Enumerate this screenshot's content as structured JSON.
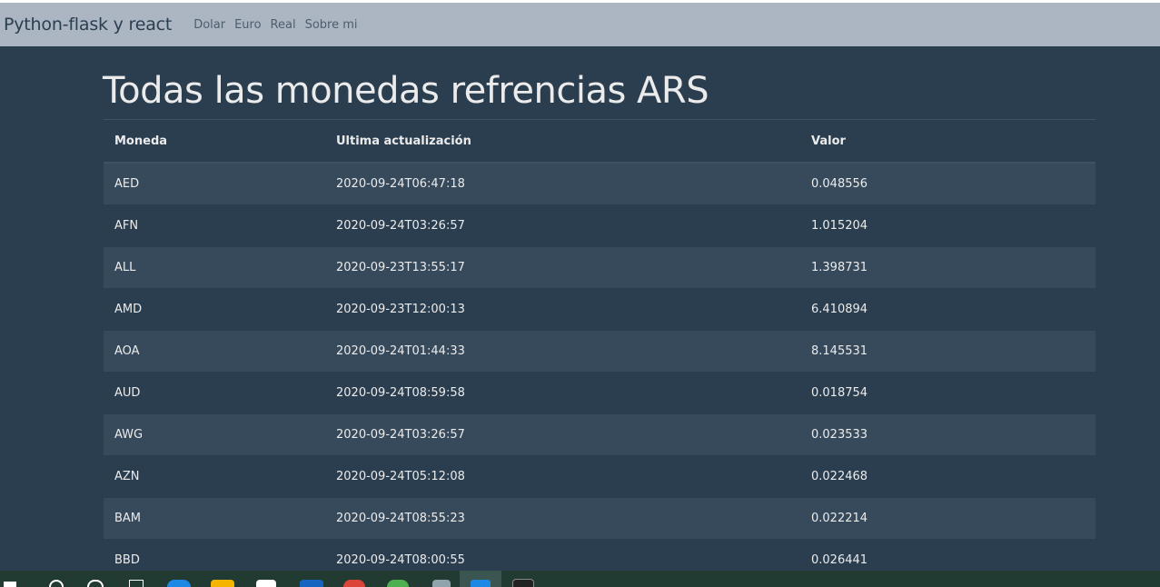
{
  "navbar": {
    "brand": "Python-flask y react",
    "links": [
      "Dolar",
      "Euro",
      "Real",
      "Sobre mi"
    ]
  },
  "main": {
    "title": "Todas las monedas refrencias ARS",
    "table": {
      "headers": [
        "Moneda",
        "Ultima actualización",
        "Valor"
      ],
      "rows": [
        [
          "AED",
          "2020-09-24T06:47:18",
          "0.048556"
        ],
        [
          "AFN",
          "2020-09-24T03:26:57",
          "1.015204"
        ],
        [
          "ALL",
          "2020-09-23T13:55:17",
          "1.398731"
        ],
        [
          "AMD",
          "2020-09-23T12:00:13",
          "6.410894"
        ],
        [
          "AOA",
          "2020-09-24T01:44:33",
          "8.145531"
        ],
        [
          "AUD",
          "2020-09-24T08:59:58",
          "0.018754"
        ],
        [
          "AWG",
          "2020-09-24T03:26:57",
          "0.023533"
        ],
        [
          "AZN",
          "2020-09-24T05:12:08",
          "0.022468"
        ],
        [
          "BAM",
          "2020-09-24T08:55:23",
          "0.022214"
        ],
        [
          "BBD",
          "2020-09-24T08:00:55",
          "0.026441"
        ]
      ]
    }
  },
  "taskbar": {
    "icons": [
      "windows-start-icon",
      "search-icon",
      "cortana-icon",
      "task-view-icon",
      "edge-icon",
      "file-explorer-icon",
      "store-icon",
      "mail-icon",
      "chrome-icon",
      "app-icon",
      "notepad-icon",
      "photos-icon",
      "terminal-icon"
    ],
    "colors": {
      "edge": "#1e88e5",
      "explorer": "#f4b400",
      "store": "#ffffff",
      "mail": "#1565c0",
      "chrome": "#db4437",
      "app": "#4caf50",
      "notepad": "#90a4ae",
      "terminal": "#222222"
    }
  }
}
